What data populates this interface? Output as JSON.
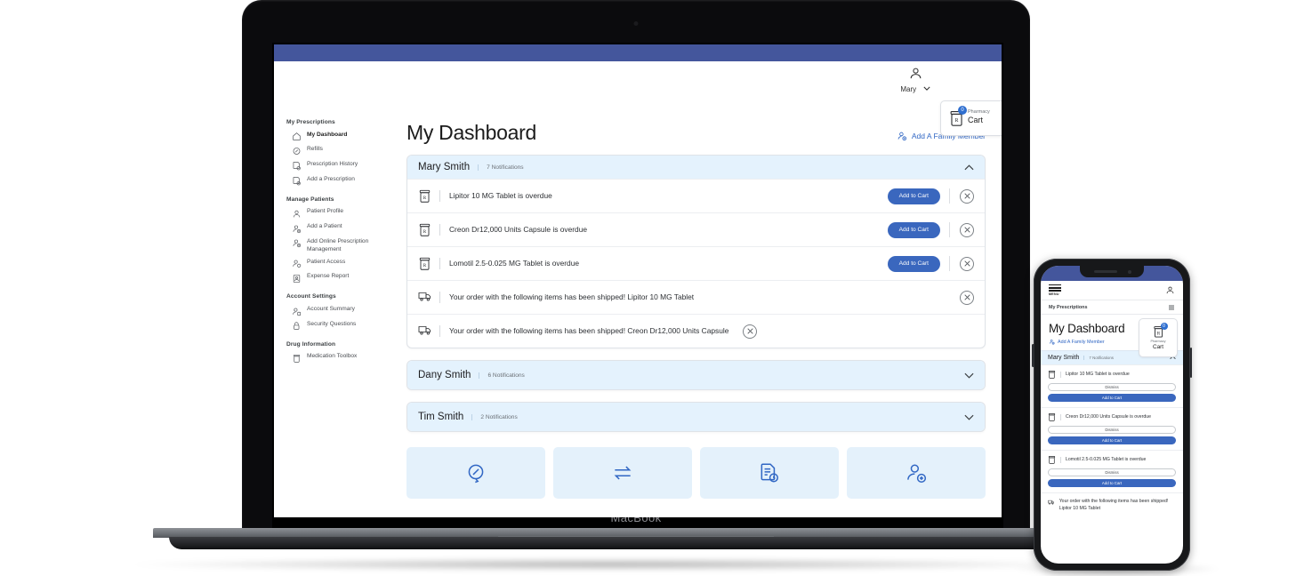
{
  "device": {
    "laptop_label": "MacBook"
  },
  "topnav": {
    "user_name": "Mary",
    "cart_small_label": "Pharmacy",
    "cart_label": "Cart",
    "cart_badge": "0"
  },
  "sidebar": {
    "groups": [
      {
        "title": "My Prescriptions",
        "items": [
          {
            "label": "My Dashboard",
            "icon": "home-icon",
            "active": true
          },
          {
            "label": "Refills",
            "icon": "pill-refill-icon",
            "active": false
          },
          {
            "label": "Prescription History",
            "icon": "document-clock-icon",
            "active": false
          },
          {
            "label": "Add a Prescription",
            "icon": "document-add-icon",
            "active": false
          }
        ]
      },
      {
        "title": "Manage Patients",
        "items": [
          {
            "label": "Patient Profile",
            "icon": "person-icon",
            "active": false
          },
          {
            "label": "Add a Patient",
            "icon": "person-add-icon",
            "active": false
          },
          {
            "label": "Add Online Prescription Management",
            "icon": "person-add-icon",
            "active": false
          },
          {
            "label": "Patient Access",
            "icon": "person-key-icon",
            "active": false
          },
          {
            "label": "Expense Report",
            "icon": "report-icon",
            "active": false
          }
        ]
      },
      {
        "title": "Account Settings",
        "items": [
          {
            "label": "Account Summary",
            "icon": "person-card-icon",
            "active": false
          },
          {
            "label": "Security Questions",
            "icon": "lock-icon",
            "active": false
          }
        ]
      },
      {
        "title": "Drug Information",
        "items": [
          {
            "label": "Medication Toolbox",
            "icon": "pill-bottle-icon",
            "active": false
          }
        ]
      }
    ]
  },
  "main": {
    "page_title": "My Dashboard",
    "add_family_label": "Add A Family Member",
    "patients": [
      {
        "name": "Mary Smith",
        "notifications_label": "7 Notifications",
        "expanded": true,
        "rows": [
          {
            "icon": "pill-bottle-icon",
            "text": "Lipitor 10 MG Tablet is overdue",
            "cart_label": "Add to Cart",
            "has_cart": true
          },
          {
            "icon": "pill-bottle-icon",
            "text": "Creon Dr12,000 Units Capsule is overdue",
            "cart_label": "Add to Cart",
            "has_cart": true
          },
          {
            "icon": "pill-bottle-icon",
            "text": "Lomotil 2.5-0.025 MG Tablet is overdue",
            "cart_label": "Add to Cart",
            "has_cart": true
          },
          {
            "icon": "truck-icon",
            "text": "Your order with the following items has been shipped! Lipitor 10 MG Tablet",
            "has_cart": false
          },
          {
            "icon": "truck-icon",
            "text": "Your order with the following items has been shipped! Creon Dr12,000 Units Capsule",
            "has_cart": false
          }
        ]
      },
      {
        "name": "Dany Smith",
        "notifications_label": "6 Notifications",
        "expanded": false,
        "rows": []
      },
      {
        "name": "Tim Smith",
        "notifications_label": "2 Notifications",
        "expanded": false,
        "rows": []
      }
    ],
    "quick_cards": [
      {
        "icon": "pill-refill-icon"
      },
      {
        "icon": "transfer-arrows-icon"
      },
      {
        "icon": "document-clock-icon"
      },
      {
        "icon": "person-add-icon"
      }
    ]
  },
  "phone": {
    "menu_label": "MENU",
    "subnav_label": "My Prescriptions",
    "page_title": "My Dashboard",
    "add_family_label": "Add A Family Member",
    "cart_small_label": "Pharmacy",
    "cart_label": "Cart",
    "cart_badge": "0",
    "patient_name": "Mary Smith",
    "patient_notifications": "7 Notifications",
    "items": [
      {
        "text": "Lipitor 10 MG Tablet is overdue",
        "dismiss_label": "Dismiss",
        "cart_label": "Add to Cart"
      },
      {
        "text": "Creon Dr12,000 Units Capsule is overdue",
        "dismiss_label": "Dismiss",
        "cart_label": "Add to Cart"
      },
      {
        "text": "Lomotil 2.5-0.025 MG Tablet is overdue",
        "dismiss_label": "Dismiss",
        "cart_label": "Add to Cart"
      }
    ],
    "shipped_text": "Your order with the following items has been shipped! Lipitor 10 MG Tablet"
  },
  "colors": {
    "header_blue": "#44569c",
    "button_blue": "#3a67be",
    "link_blue": "#3167c4",
    "panel_blue": "#e4f2fd"
  }
}
